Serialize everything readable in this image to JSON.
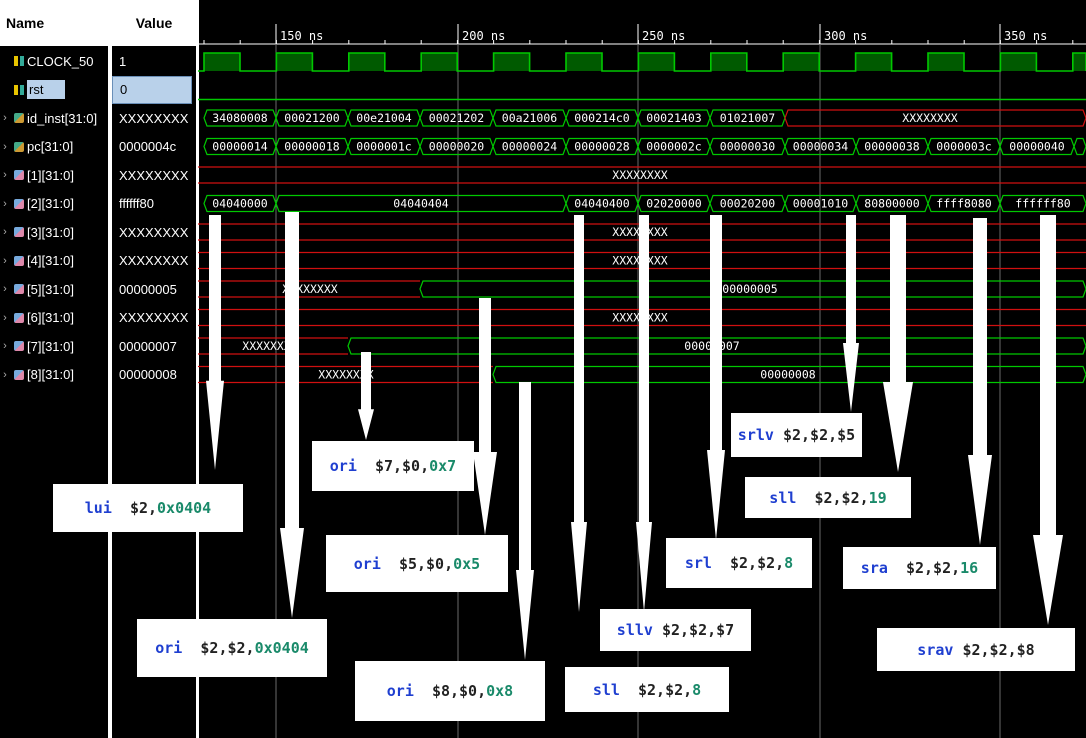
{
  "columns": {
    "name": "Name",
    "value": "Value"
  },
  "signals": [
    {
      "name": "CLOCK_50",
      "value": "1",
      "kind": "bit",
      "expand": false
    },
    {
      "name": "rst",
      "value": "0",
      "kind": "bit",
      "expand": false,
      "selected": true
    },
    {
      "name": "id_inst[31:0]",
      "value": "XXXXXXXX",
      "kind": "bus",
      "expand": true
    },
    {
      "name": "pc[31:0]",
      "value": "0000004c",
      "kind": "bus",
      "expand": true
    },
    {
      "name": "[1][31:0]",
      "value": "XXXXXXXX",
      "kind": "bus2",
      "expand": true
    },
    {
      "name": "[2][31:0]",
      "value": "ffffff80",
      "kind": "bus2",
      "expand": true
    },
    {
      "name": "[3][31:0]",
      "value": "XXXXXXXX",
      "kind": "bus2",
      "expand": true
    },
    {
      "name": "[4][31:0]",
      "value": "XXXXXXXX",
      "kind": "bus2",
      "expand": true
    },
    {
      "name": "[5][31:0]",
      "value": "00000005",
      "kind": "bus2",
      "expand": true
    },
    {
      "name": "[6][31:0]",
      "value": "XXXXXXXX",
      "kind": "bus2",
      "expand": true
    },
    {
      "name": "[7][31:0]",
      "value": "00000007",
      "kind": "bus2",
      "expand": true
    },
    {
      "name": "[8][31:0]",
      "value": "00000008",
      "kind": "bus2",
      "expand": true
    }
  ],
  "timescale": {
    "labels": [
      "150 ns",
      "200 ns",
      "250 ns",
      "300 ns",
      "350 ns"
    ]
  },
  "waveforms": {
    "id_inst": [
      "34080008",
      "00021200",
      "00e21004",
      "00021202",
      "00a21006",
      "000214c0",
      "00021403",
      "01021007",
      "XXXXXXXX"
    ],
    "pc": [
      "00000014",
      "00000018",
      "0000001c",
      "00000020",
      "00000024",
      "00000028",
      "0000002c",
      "00000030",
      "00000034",
      "00000038",
      "0000003c",
      "00000040"
    ],
    "r1": [
      "XXXXXXXX"
    ],
    "r2": [
      "04040000",
      "04040404",
      "04040400",
      "02020000",
      "00020200",
      "00001010",
      "80800000",
      "ffff8080",
      "ffffff80"
    ],
    "r3": [
      "XXXXXXXX"
    ],
    "r4": [
      "XXXXXXXX"
    ],
    "r5": [
      "XXXXXXXX",
      "00000005"
    ],
    "r6": [
      "XXXXXXXX"
    ],
    "r7": [
      "XXXXXXXX",
      "00000007"
    ],
    "r8": [
      "XXXXXXXX",
      "00000008"
    ]
  },
  "annotations": [
    {
      "op": "lui",
      "args": [
        [
          "reg",
          "$2"
        ],
        [
          "p",
          ","
        ],
        [
          "imm",
          "0x0404"
        ]
      ],
      "pad": "  "
    },
    {
      "op": "ori",
      "args": [
        [
          "reg",
          "$2"
        ],
        [
          "p",
          ","
        ],
        [
          "reg",
          "$2"
        ],
        [
          "p",
          ","
        ],
        [
          "imm",
          "0x0404"
        ]
      ],
      "pad": "  "
    },
    {
      "op": "ori",
      "args": [
        [
          "reg",
          "$7"
        ],
        [
          "p",
          ","
        ],
        [
          "reg",
          "$0"
        ],
        [
          "p",
          ","
        ],
        [
          "imm",
          "0x7"
        ]
      ],
      "pad": "  "
    },
    {
      "op": "ori",
      "args": [
        [
          "reg",
          "$5"
        ],
        [
          "p",
          ","
        ],
        [
          "reg",
          "$0"
        ],
        [
          "p",
          ","
        ],
        [
          "imm",
          "0x5"
        ]
      ],
      "pad": "  "
    },
    {
      "op": "ori",
      "args": [
        [
          "reg",
          "$8"
        ],
        [
          "p",
          ","
        ],
        [
          "reg",
          "$0"
        ],
        [
          "p",
          ","
        ],
        [
          "imm",
          "0x8"
        ]
      ],
      "pad": "  "
    },
    {
      "op": "sll",
      "args": [
        [
          "reg",
          "$2"
        ],
        [
          "p",
          ","
        ],
        [
          "reg",
          "$2"
        ],
        [
          "p",
          ","
        ],
        [
          "imm",
          "8"
        ]
      ],
      "pad": "  "
    },
    {
      "op": "sllv",
      "args": [
        [
          "reg",
          "$2"
        ],
        [
          "p",
          ","
        ],
        [
          "reg",
          "$2"
        ],
        [
          "p",
          ","
        ],
        [
          "reg",
          "$7"
        ]
      ],
      "pad": " "
    },
    {
      "op": "srl",
      "args": [
        [
          "reg",
          "$2"
        ],
        [
          "p",
          ","
        ],
        [
          "reg",
          "$2"
        ],
        [
          "p",
          ","
        ],
        [
          "imm",
          "8"
        ]
      ],
      "pad": "  "
    },
    {
      "op": "srlv",
      "args": [
        [
          "reg",
          "$2"
        ],
        [
          "p",
          ","
        ],
        [
          "reg",
          "$2"
        ],
        [
          "p",
          ","
        ],
        [
          "reg",
          "$5"
        ]
      ],
      "pad": " "
    },
    {
      "op": "sll",
      "args": [
        [
          "reg",
          "$2"
        ],
        [
          "p",
          ","
        ],
        [
          "reg",
          "$2"
        ],
        [
          "p",
          ","
        ],
        [
          "imm",
          "19"
        ]
      ],
      "pad": "  "
    },
    {
      "op": "sra",
      "args": [
        [
          "reg",
          "$2"
        ],
        [
          "p",
          ","
        ],
        [
          "reg",
          "$2"
        ],
        [
          "p",
          ","
        ],
        [
          "imm",
          "16"
        ]
      ],
      "pad": "  "
    },
    {
      "op": "srav",
      "args": [
        [
          "reg",
          "$2"
        ],
        [
          "p",
          ","
        ],
        [
          "reg",
          "$2"
        ],
        [
          "p",
          ","
        ],
        [
          "reg",
          "$8"
        ]
      ],
      "pad": " "
    }
  ],
  "colors": {
    "wave": "#00c800",
    "undefined": "#d01010",
    "clock_fill": "#005a00",
    "grid": "#6a6a6a"
  },
  "icons": {
    "bit": "bit-signal-icon",
    "bus": "bus-signal-icon",
    "bus2": "array-element-icon",
    "expand": "expand-chevron-icon"
  }
}
